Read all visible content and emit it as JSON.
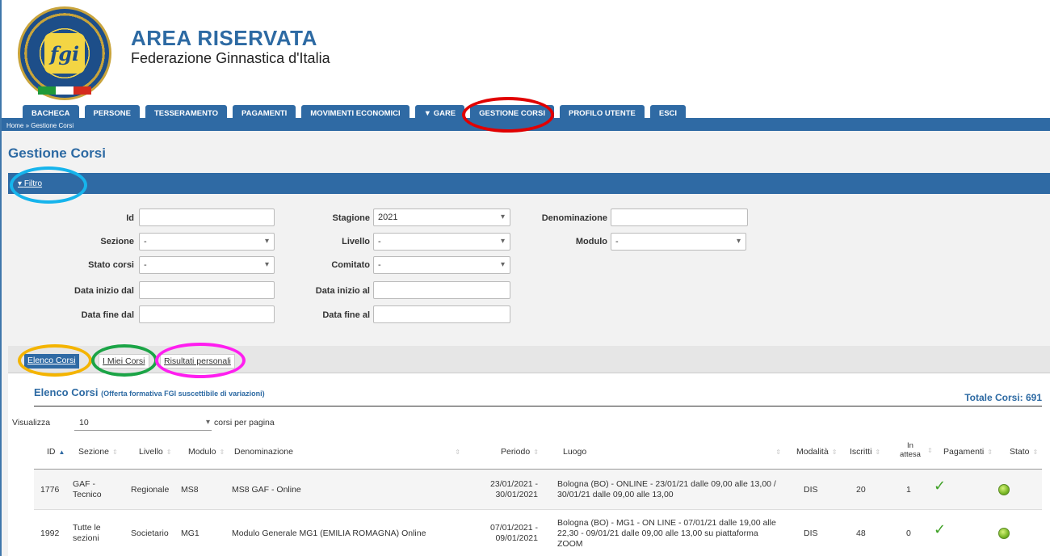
{
  "header": {
    "title": "AREA RISERVATA",
    "subtitle": "Federazione Ginnastica d'Italia",
    "logo_text": "fgi"
  },
  "nav": {
    "tabs": [
      {
        "label": "BACHECA"
      },
      {
        "label": "PERSONE"
      },
      {
        "label": "TESSERAMENTO"
      },
      {
        "label": "PAGAMENTI"
      },
      {
        "label": "MOVIMENTI ECONOMICI"
      },
      {
        "label": "▼ GARE"
      },
      {
        "label": "GESTIONE CORSI"
      },
      {
        "label": "PROFILO UTENTE"
      },
      {
        "label": "ESCI"
      }
    ],
    "breadcrumb": "Home » Gestione Corsi"
  },
  "page": {
    "title": "Gestione Corsi"
  },
  "filter": {
    "toggle_label": "Filtro",
    "fields": {
      "id_label": "Id",
      "id_value": "",
      "stagione_label": "Stagione",
      "stagione_value": "2021",
      "denominazione_label": "Denominazione",
      "denominazione_value": "",
      "sezione_label": "Sezione",
      "sezione_value": "-",
      "livello_label": "Livello",
      "livello_value": "-",
      "modulo_label": "Modulo",
      "modulo_value": "-",
      "stato_corsi_label": "Stato corsi",
      "stato_corsi_value": "-",
      "comitato_label": "Comitato",
      "comitato_value": "-",
      "data_inizio_dal_label": "Data inizio dal",
      "data_inizio_al_label": "Data inizio al",
      "data_fine_dal_label": "Data fine dal",
      "data_fine_al_label": "Data fine al"
    }
  },
  "subtabs": {
    "elenco": "Elenco Corsi",
    "miei": "I Miei Corsi",
    "risultati": "Risultati personali"
  },
  "list": {
    "title": "Elenco Corsi",
    "subtitle": "(Offerta formativa FGI suscettibile di variazioni)",
    "total": "Totale Corsi: 691",
    "show_label": "Visualizza",
    "page_size": "10",
    "per_page_label": "corsi per pagina",
    "columns": [
      "ID",
      "Sezione",
      "Livello",
      "Modulo",
      "Denominazione",
      "Periodo",
      "Luogo",
      "Modalità",
      "Iscritti",
      "In attesa",
      "Pagamenti",
      "Stato"
    ],
    "rows": [
      {
        "id": "1776",
        "sezione": "GAF - Tecnico",
        "livello": "Regionale",
        "modulo": "MS8",
        "denominazione": "MS8 GAF - Online",
        "periodo": "23/01/2021 - 30/01/2021",
        "luogo": "Bologna (BO) - ONLINE - 23/01/21 dalle 09,00 alle 13,00 / 30/01/21 dalle 09,00 alle 13,00",
        "modalita": "DIS",
        "iscritti": "20",
        "in_attesa": "1"
      },
      {
        "id": "1992",
        "sezione": "Tutte le sezioni",
        "livello": "Societario",
        "modulo": "MG1",
        "denominazione": "Modulo Generale MG1 (EMILIA ROMAGNA) Online",
        "periodo": "07/01/2021 - 09/01/2021",
        "luogo": "Bologna (BO) - MG1 - ON LINE - 07/01/21 dalle 19,00 alle 22,30 - 09/01/21 dalle 09,00 alle 13,00 su piattaforma ZOOM",
        "modalita": "DIS",
        "iscritti": "48",
        "in_attesa": "0"
      }
    ]
  },
  "colors": {
    "primary": "#2f6aa4",
    "ring_red": "#e10000",
    "ring_cyan": "#16b4ec",
    "ring_orange": "#f4b400",
    "ring_green": "#1ba446",
    "ring_magenta": "#ff1ef0"
  }
}
